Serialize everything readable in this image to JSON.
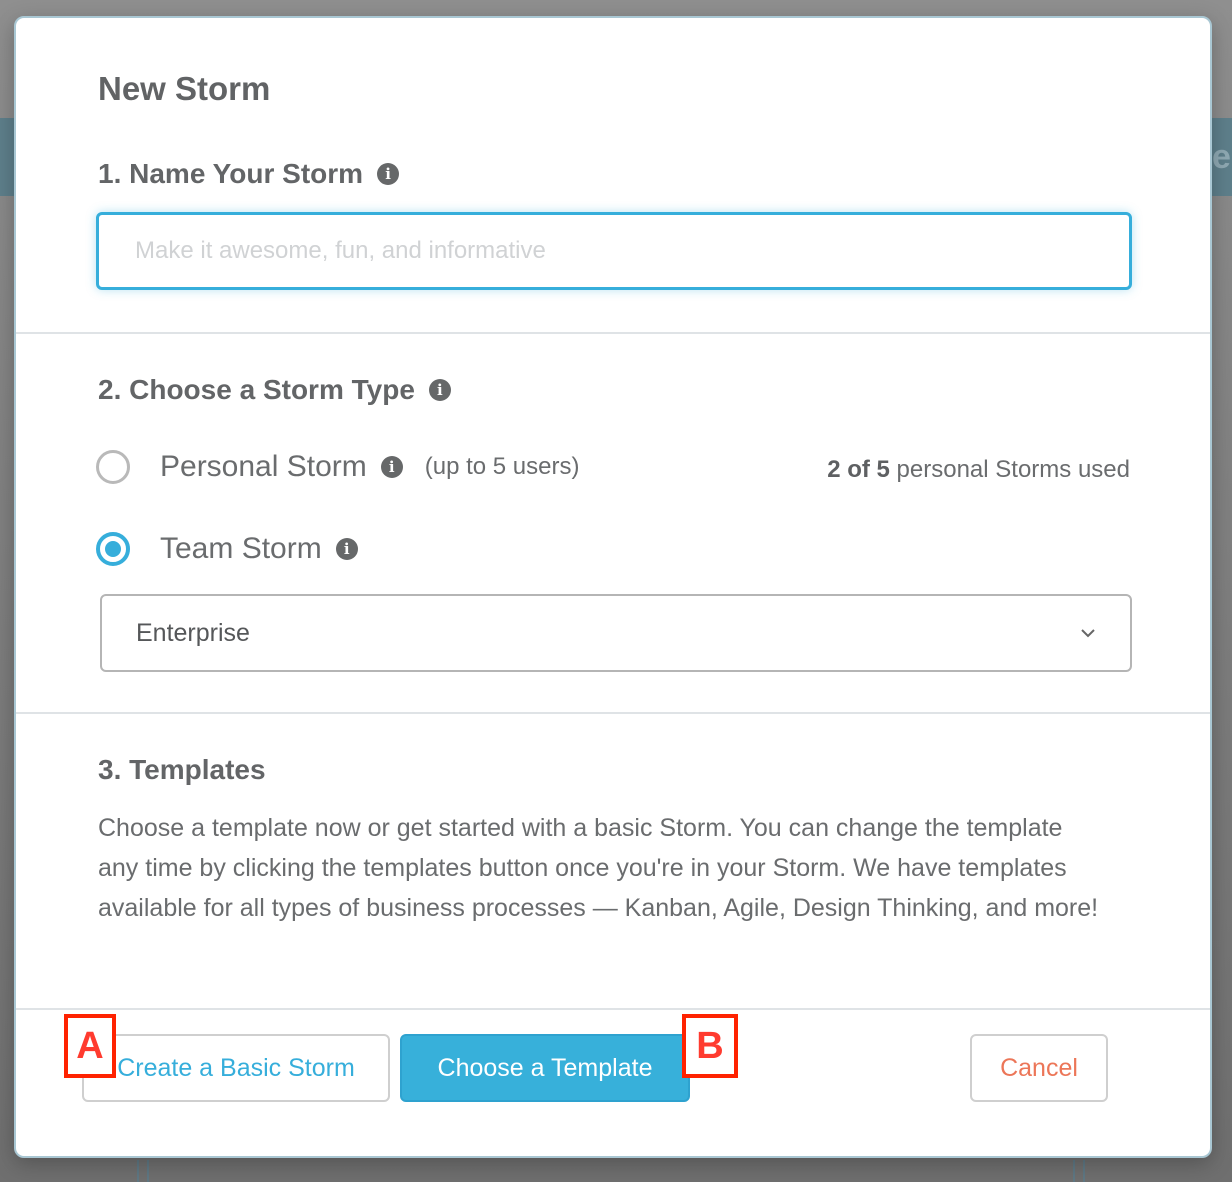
{
  "modal": {
    "title": "New Storm",
    "section1": {
      "heading": "1. Name Your Storm",
      "input_value": "",
      "input_placeholder": "Make it awesome, fun, and informative"
    },
    "section2": {
      "heading": "2. Choose a Storm Type",
      "options": [
        {
          "label": "Personal Storm",
          "note": "(up to 5 users)",
          "selected": false
        },
        {
          "label": "Team Storm",
          "note": "",
          "selected": true
        }
      ],
      "usage_bold": "2 of 5",
      "usage_rest": " personal Storms used",
      "team_select_value": "Enterprise"
    },
    "section3": {
      "heading": "3. Templates",
      "description": "Choose a template now or get started with a basic Storm. You can change the template any time by clicking the templates button once you're in your Storm. We have templates available for all types of business processes — Kanban, Agile, Design Thinking, and more!"
    },
    "buttons": {
      "basic": "Create a Basic Storm",
      "template": "Choose a Template",
      "cancel": "Cancel"
    }
  },
  "annotations": {
    "a": "A",
    "b": "B"
  },
  "icons": {
    "info": "i"
  },
  "colors": {
    "accent": "#36aedb",
    "cancel": "#ec7658",
    "marker": "#ff2200"
  }
}
